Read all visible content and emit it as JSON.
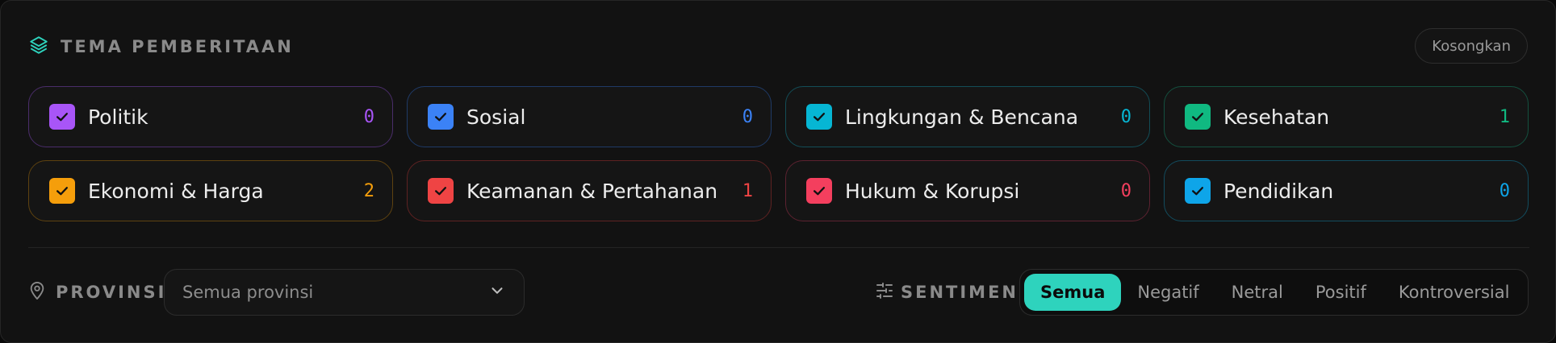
{
  "header": {
    "title": "TEMA PEMBERITAAN",
    "icon": "layers-icon",
    "clear_label": "Kosongkan"
  },
  "topics": [
    {
      "label": "Politik",
      "count": "0",
      "color": "#a855f7",
      "border": "#4a2d6a"
    },
    {
      "label": "Sosial",
      "count": "0",
      "color": "#3b82f6",
      "border": "#1f3a66"
    },
    {
      "label": "Lingkungan & Bencana",
      "count": "0",
      "color": "#06b6d4",
      "border": "#134d57"
    },
    {
      "label": "Kesehatan",
      "count": "1",
      "color": "#10b981",
      "border": "#14503f"
    },
    {
      "label": "Ekonomi & Harga",
      "count": "2",
      "color": "#f59e0b",
      "border": "#5e4210"
    },
    {
      "label": "Keamanan & Pertahanan",
      "count": "1",
      "color": "#ef4444",
      "border": "#5e2222"
    },
    {
      "label": "Hukum & Korupsi",
      "count": "0",
      "color": "#f43f5e",
      "border": "#5c2230"
    },
    {
      "label": "Pendidikan",
      "count": "0",
      "color": "#0ea5e9",
      "border": "#124c5e"
    }
  ],
  "province": {
    "label": "PROVINSI",
    "icon": "map-pin-icon",
    "value": "Semua provinsi"
  },
  "sentiment": {
    "label": "SENTIMEN",
    "icon": "sliders-icon",
    "options": [
      "Semua",
      "Negatif",
      "Netral",
      "Positif",
      "Kontroversial"
    ],
    "selected": "Semua",
    "accent": "#2ed3bd"
  }
}
